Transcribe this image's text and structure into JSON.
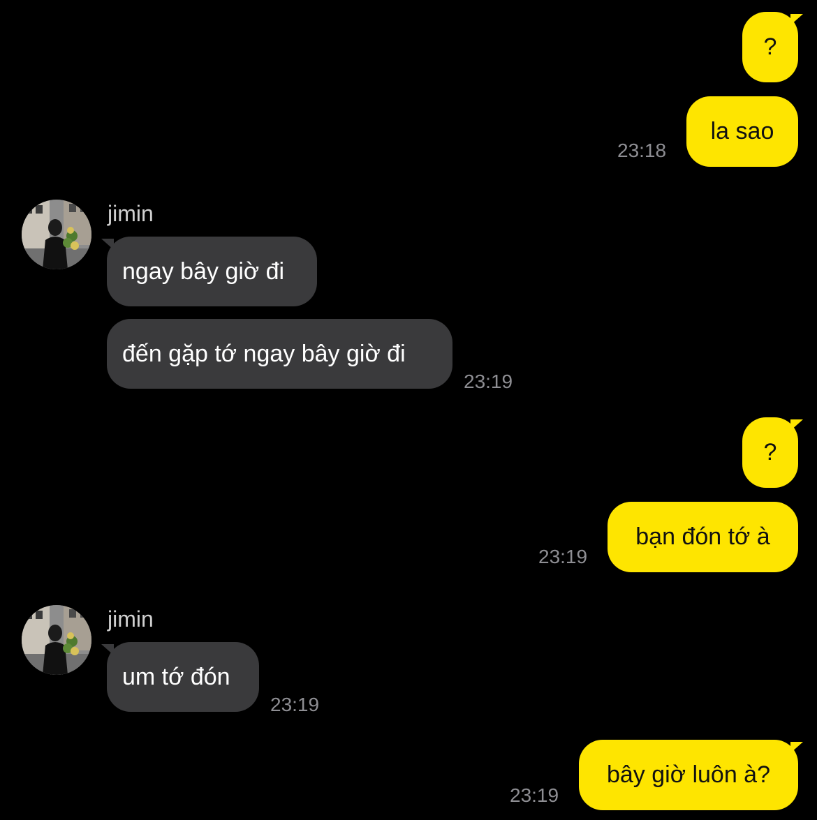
{
  "colors": {
    "background": "#000000",
    "outgoing_bubble": "#FEE500",
    "incoming_bubble": "#3A3A3C",
    "timestamp": "#8E8E93"
  },
  "messages": [
    {
      "side": "out",
      "text": "?"
    },
    {
      "side": "out",
      "text": "la sao",
      "time": "23:18"
    },
    {
      "side": "in",
      "sender": "jimin",
      "text": "ngay bây giờ đi"
    },
    {
      "side": "in",
      "text": "đến gặp tớ ngay bây giờ đi",
      "time": "23:19"
    },
    {
      "side": "out",
      "text": "?"
    },
    {
      "side": "out",
      "text": "bạn đón tớ à",
      "time": "23:19"
    },
    {
      "side": "in",
      "sender": "jimin",
      "text": "um tớ đón",
      "time": "23:19"
    },
    {
      "side": "out",
      "text": "bây giờ luôn à?",
      "time": "23:19"
    }
  ],
  "avatar_icon": "user-photo-avatar"
}
